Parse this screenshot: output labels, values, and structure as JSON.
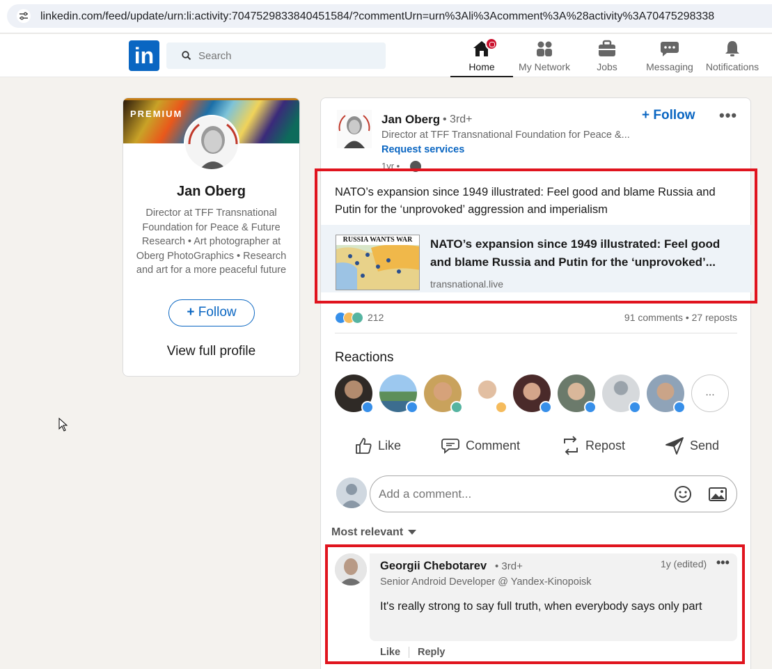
{
  "browser": {
    "url": "linkedin.com/feed/update/urn:li:activity:7047529833840451584/?commentUrn=urn%3Ali%3Acomment%3A%28activity%3A70475298338"
  },
  "nav": {
    "search_placeholder": "Search",
    "items": [
      {
        "label": "Home",
        "icon": "home-icon"
      },
      {
        "label": "My Network",
        "icon": "people-icon"
      },
      {
        "label": "Jobs",
        "icon": "briefcase-icon"
      },
      {
        "label": "Messaging",
        "icon": "chat-icon"
      },
      {
        "label": "Notifications",
        "icon": "bell-icon"
      }
    ],
    "logo": "in"
  },
  "profile_card": {
    "premium": "PREMIUM",
    "name": "Jan Oberg",
    "headline": "Director at TFF Transnational Foundation for Peace & Future Research • Art photographer at Oberg PhotoGraphics • Research and art for a more peaceful future",
    "follow_label": "Follow",
    "view_profile": "View full profile"
  },
  "post": {
    "author_name": "Jan Oberg",
    "author_degree": "• 3rd+",
    "author_headline": "Director at TFF Transnational Foundation for Peace &...",
    "request_services": "Request services",
    "time": "1yr •",
    "follow_label": "Follow",
    "more": "•••",
    "text": "NATO’s expansion since 1949 illustrated: Feel good and blame Russia and Putin for the ‘unprovoked’ aggression and imperialism",
    "link": {
      "thumb_title": "RUSSIA WANTS WAR",
      "title": "NATO’s expansion since 1949 illustrated: Feel good and blame Russia and Putin for the ‘unprovoked’...",
      "domain": "transnational.live"
    },
    "reaction_count": "212",
    "comments_reposts": "91 comments • 27 reposts",
    "reactions_heading": "Reactions",
    "reactors_more": "...",
    "actions": {
      "like": "Like",
      "comment": "Comment",
      "repost": "Repost",
      "send": "Send"
    },
    "comment_placeholder": "Add a comment...",
    "sort_label": "Most relevant"
  },
  "comment": {
    "name": "Georgii Chebotarev",
    "degree": "• 3rd+",
    "time": "1y (edited)",
    "more": "•••",
    "headline": "Senior Android Developer @ Yandex-Kinopoisk",
    "text": "It's really strong to say full truth, when everybody says only part",
    "like": "Like",
    "reply": "Reply"
  },
  "colors": {
    "brand": "#0a66c2",
    "highlight": "#e0141e",
    "notification": "#cb112d"
  }
}
